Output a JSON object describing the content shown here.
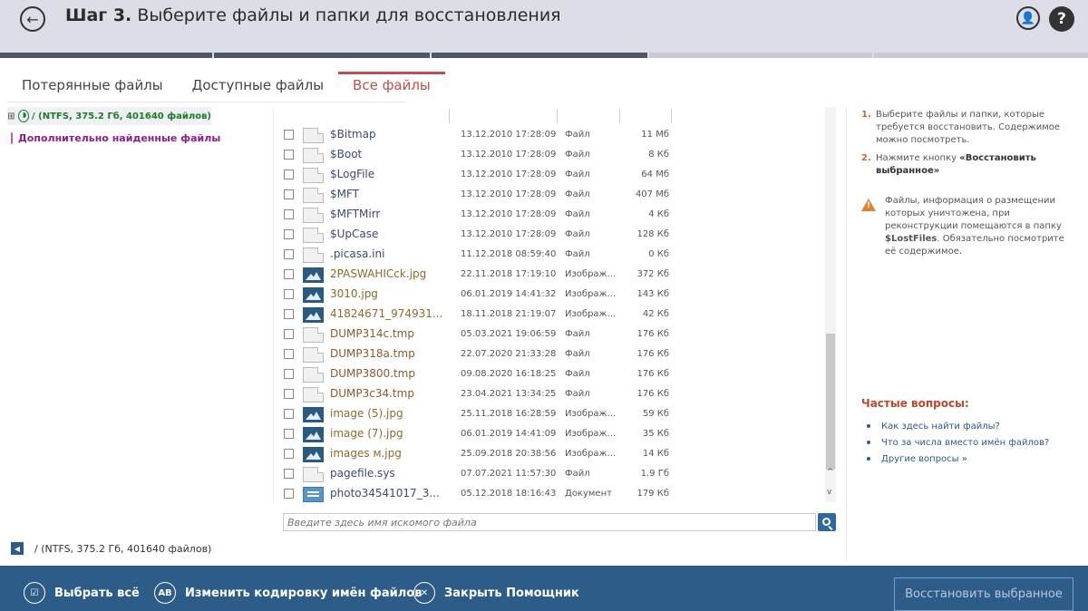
{
  "header": {
    "step_label": "Шаг 3.",
    "title": "Выберите файлы и папки для восстановления",
    "back_icon": "←",
    "user_icon": "👤",
    "help_label": "?"
  },
  "tabs": [
    {
      "label": "Потерянные файлы",
      "active": false
    },
    {
      "label": "Доступные файлы",
      "active": false
    },
    {
      "label": "Все файлы",
      "active": true
    }
  ],
  "tree": {
    "expand": "⊞",
    "root_label": "/ (NTFS, 375.2 Гб, 401640 файлов)",
    "extra_label": "Дополнительно найденные файлы"
  },
  "files": [
    {
      "name": "$Bitmap",
      "date": "13.12.2010 17:28:09",
      "type": "Файл",
      "size": "11 Мб",
      "icon": "sys"
    },
    {
      "name": "$Boot",
      "date": "13.12.2010 17:28:09",
      "type": "Файл",
      "size": "8 Кб",
      "icon": "sys"
    },
    {
      "name": "$LogFile",
      "date": "13.12.2010 17:28:09",
      "type": "Файл",
      "size": "64 Мб",
      "icon": "sys"
    },
    {
      "name": "$MFT",
      "date": "13.12.2010 17:28:09",
      "type": "Файл",
      "size": "407 Мб",
      "icon": "sys"
    },
    {
      "name": "$MFTMirr",
      "date": "13.12.2010 17:28:09",
      "type": "Файл",
      "size": "4 Кб",
      "icon": "sys"
    },
    {
      "name": "$UpCase",
      "date": "13.12.2010 17:28:09",
      "type": "Файл",
      "size": "128 Кб",
      "icon": "sys"
    },
    {
      "name": ".picasa.ini",
      "date": "11.12.2018 08:59:40",
      "type": "Файл",
      "size": "0 Кб",
      "icon": "sys"
    },
    {
      "name": "2PASWAHICck.jpg",
      "date": "22.11.2018 17:19:10",
      "type": "Изображ...",
      "size": "372 Кб",
      "icon": "img"
    },
    {
      "name": "3010.jpg",
      "date": "06.01.2019 14:41:32",
      "type": "Изображ...",
      "size": "143 Кб",
      "icon": "img"
    },
    {
      "name": "41824671_974931...",
      "date": "18.11.2018 21:19:07",
      "type": "Изображ...",
      "size": "42 Кб",
      "icon": "img"
    },
    {
      "name": "DUMP314c.tmp",
      "date": "05.03.2021 19:06:59",
      "type": "Файл",
      "size": "176 Кб",
      "icon": "tmp"
    },
    {
      "name": "DUMP318a.tmp",
      "date": "22.07.2020 21:33:28",
      "type": "Файл",
      "size": "176 Кб",
      "icon": "tmp"
    },
    {
      "name": "DUMP3800.tmp",
      "date": "09.08.2020 16:18:25",
      "type": "Файл",
      "size": "176 Кб",
      "icon": "tmp"
    },
    {
      "name": "DUMP3c34.tmp",
      "date": "23.04.2021 13:34:25",
      "type": "Файл",
      "size": "176 Кб",
      "icon": "tmp"
    },
    {
      "name": "image (5).jpg",
      "date": "25.11.2018 16:28:59",
      "type": "Изображ...",
      "size": "59 Кб",
      "icon": "img"
    },
    {
      "name": "image (7).jpg",
      "date": "06.01.2019 14:41:09",
      "type": "Изображ...",
      "size": "35 Кб",
      "icon": "img"
    },
    {
      "name": "images м.jpg",
      "date": "25.09.2018 20:38:56",
      "type": "Изображ...",
      "size": "14 Кб",
      "icon": "img"
    },
    {
      "name": "pagefile.sys",
      "date": "07.07.2021 11:57:30",
      "type": "Файл",
      "size": "1.9 Гб",
      "icon": "sys"
    },
    {
      "name": "photo34541017_3...",
      "date": "05.12.2018 18:16:43",
      "type": "Документ",
      "size": "179 Кб",
      "icon": "doc"
    }
  ],
  "scroll": {
    "up": "^",
    "down": "v"
  },
  "search": {
    "placeholder": "Введите здесь имя искомого файла"
  },
  "path_bar": {
    "back_icon": "◀",
    "path": "/ (NTFS, 375.2 Гб, 401640 файлов)"
  },
  "help_panel": {
    "step1_num": "1.",
    "step1_text": "Выберите файлы и папки, которые требуется восстановить. Содержимое можно посмотреть.",
    "step2_num": "2.",
    "step2_text_pre": "Нажмите кнопку ",
    "step2_text_bold": "«Восстановить выбранное»",
    "warning_pre": "Файлы, информация о размещении которых уничтожена, при реконструкции помещаются в папку ",
    "warning_bold": "$LostFiles",
    "warning_post": ". Обязательно посмотрите её содержимое.",
    "faq_title": "Частые вопросы:",
    "faq": [
      "Как здесь найти файлы?",
      "Что за числа вместо имён файлов?",
      "Другие вопросы »"
    ]
  },
  "bottom_bar": {
    "select_all_label": "Выбрать всё",
    "select_all_icon": "☑",
    "encoding_label": "Изменить кодировку имён файлов",
    "encoding_icon": "AB",
    "close_label": "Закрыть Помощник",
    "close_icon": "✕",
    "restore_label": "Восстановить выбранное"
  },
  "colors": {
    "accent": "#c0504d",
    "header_bg": "#dcdde6",
    "bottom_bar_bg": "#2d5c88",
    "tree_root": "#1e7a23",
    "tree_extra": "#8a1f8a"
  }
}
